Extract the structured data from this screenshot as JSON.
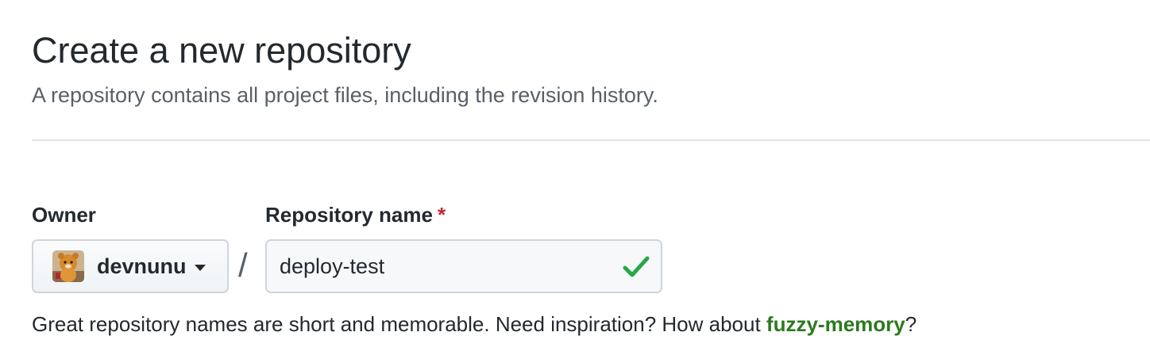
{
  "header": {
    "title": "Create a new repository",
    "subtitle": "A repository contains all project files, including the revision history."
  },
  "form": {
    "owner": {
      "label": "Owner",
      "value": "devnunu",
      "avatar_icon": "user-avatar-icon",
      "dropdown_icon": "caret-down-icon"
    },
    "separator": "/",
    "repository_name": {
      "label": "Repository name",
      "required_marker": "*",
      "value": "deploy-test",
      "valid_icon": "check-icon"
    },
    "hint": {
      "prefix": "Great repository names are short and memorable. Need inspiration? How about ",
      "suggestion": "fuzzy-memory",
      "suffix": "?"
    }
  },
  "colors": {
    "required": "#cb2431",
    "success": "#2c7a1f",
    "check": "#28a745",
    "muted_text": "#586069"
  }
}
